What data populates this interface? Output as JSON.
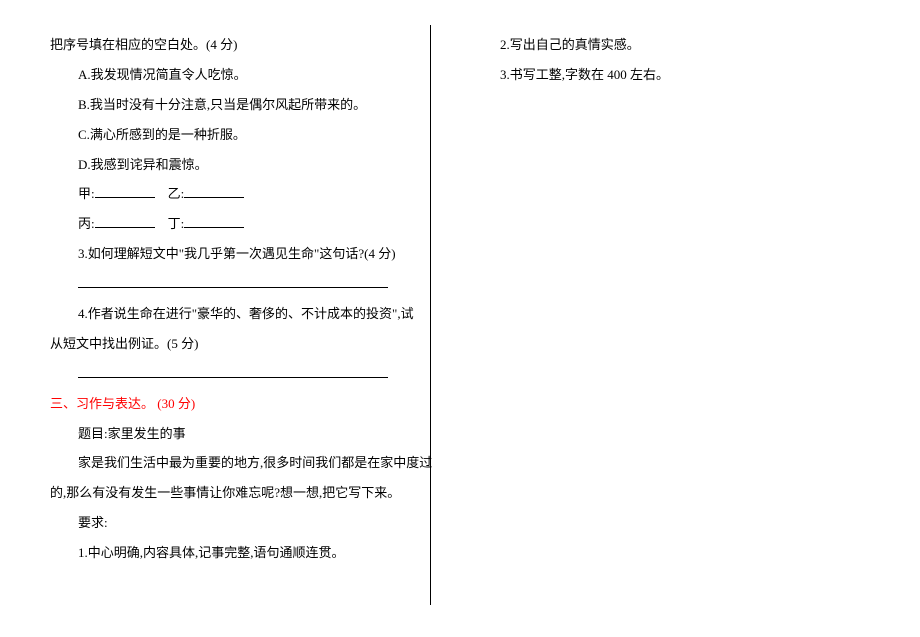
{
  "left": {
    "intro": "把序号填在相应的空白处。(4 分)",
    "optA": "A.我发现情况简直令人吃惊。",
    "optB": "B.我当时没有十分注意,只当是偶尔风起所带来的。",
    "optC": "C.满心所感到的是一种折服。",
    "optD": "D.我感到诧异和震惊。",
    "fill1a": "甲:",
    "fill1b": "乙:",
    "fill2a": "丙:",
    "fill2b": "丁:",
    "q3": "3.如何理解短文中\"我几乎第一次遇见生命\"这句话?(4 分)",
    "q4a": "4.作者说生命在进行\"豪华的、奢侈的、不计成本的投资\",试",
    "q4b": "从短文中找出例证。(5 分)",
    "section3": "三、习作与表达。 (30 分)",
    "topic": "题目:家里发生的事",
    "desc1": "家是我们生活中最为重要的地方,很多时间我们都是在家中度过",
    "desc2": "的,那么有没有发生一些事情让你难忘呢?想一想,把它写下来。",
    "req": "要求:",
    "req1": "1.中心明确,内容具体,记事完整,语句通顺连贯。"
  },
  "right": {
    "req2": "2.写出自己的真情实感。",
    "req3": "3.书写工整,字数在 400 左右。"
  }
}
